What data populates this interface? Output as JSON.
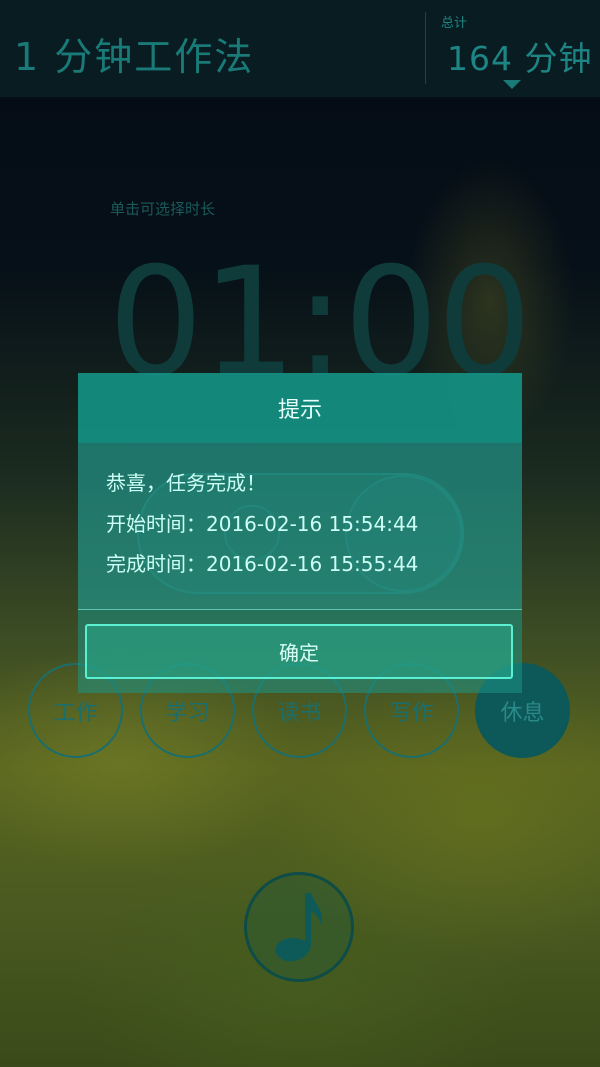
{
  "header": {
    "app_title": "1 分钟工作法",
    "total_label": "总计",
    "total_value": "164 分钟"
  },
  "timer": {
    "hint": "单击可选择时长",
    "display": "01:00"
  },
  "modes": [
    {
      "label": "工作",
      "active": false
    },
    {
      "label": "学习",
      "active": false
    },
    {
      "label": "读书",
      "active": false
    },
    {
      "label": "写作",
      "active": false
    },
    {
      "label": "休息",
      "active": true
    }
  ],
  "dialog": {
    "title": "提示",
    "message": "恭喜，任务完成！",
    "start_line": "开始时间：2016-02-16 15:54:44",
    "end_line": "完成时间：2016-02-16 15:55:44",
    "ok_label": "确定"
  },
  "colors": {
    "accent": "#1d8584",
    "dialog_header": "#14a08e",
    "button_border": "#5cf0d2"
  },
  "icons": {
    "dropdown": "chevron-down-icon",
    "music": "music-note-icon"
  }
}
